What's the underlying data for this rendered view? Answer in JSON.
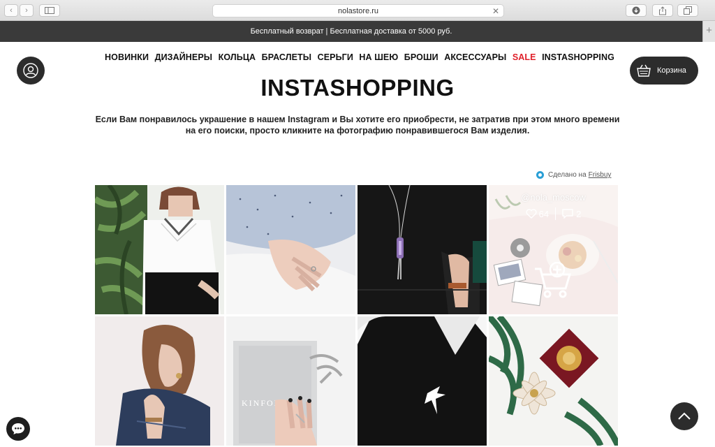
{
  "browser": {
    "url": "nolastore.ru"
  },
  "promo": {
    "text": "Бесплатный возврат | Бесплатная доставка от 5000 руб."
  },
  "nav": [
    "НОВИНКИ",
    "ДИЗАЙНЕРЫ",
    "КОЛЬЦА",
    "БРАСЛЕТЫ",
    "СЕРЬГИ",
    "НА ШЕЮ",
    "БРОШИ",
    "АКСЕССУАРЫ",
    "SALE",
    "INSTASHOPPING"
  ],
  "cart": {
    "label": "Корзина"
  },
  "page": {
    "title": "INSTASHOPPING",
    "description": "Если Вам понравилось украшение в нашем Instagram и Вы хотите его приобрести, не затратив при этом много времени на его поиски, просто кликните на фотографию понравившегося Вам изделия."
  },
  "made_by": {
    "prefix": "Сделано на",
    "link": "Frisbuy"
  },
  "hover_card": {
    "username": "@nola_moscow",
    "likes": "64",
    "comments": "2"
  },
  "colors": {
    "accent_sale": "#e0202a",
    "dark": "#2c2c2c",
    "promo_bg": "#3a3a3a",
    "frisbuy": "#2a9fd6"
  }
}
